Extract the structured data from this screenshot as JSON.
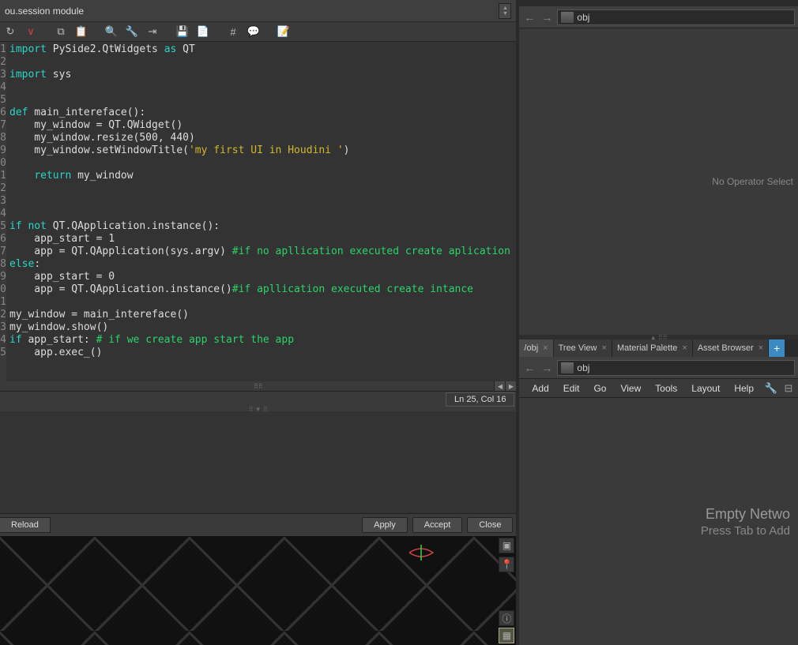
{
  "title": "ou.session module",
  "status": "Ln 25, Col 16",
  "code_lines": [
    "1",
    "2",
    "3",
    "4",
    "5",
    "6",
    "7",
    "8",
    "9",
    "0",
    "1",
    "2",
    "3",
    "4",
    "5",
    "6",
    "7",
    "8",
    "9",
    "0",
    "1",
    "2",
    "3",
    "4",
    "5"
  ],
  "buttons": {
    "reload": "Reload",
    "apply": "Apply",
    "accept": "Accept",
    "close": "Close"
  },
  "right": {
    "path": "obj",
    "no_op": "No Operator Select",
    "tabs": [
      "/obj",
      "Tree View",
      "Material Palette",
      "Asset Browser"
    ],
    "path2": "obj",
    "menu": [
      "Add",
      "Edit",
      "Go",
      "View",
      "Tools",
      "Layout",
      "Help"
    ],
    "empty1": "Empty Netwo",
    "empty2": "Press Tab to Add "
  },
  "code": {
    "l1_kw": "import",
    "l1_rest": " PySide2.QtWidgets ",
    "l1_as": "as",
    "l1_end": " QT",
    "l3_kw": "import",
    "l3_rest": " sys",
    "l6_kw": "def",
    "l6_rest": " main_intereface():",
    "l7": "    my_window = QT.QWidget()",
    "l8": "    my_window.resize(500, 440)",
    "l9a": "    my_window.setWindowTitle(",
    "l9_str": "'my first UI in Houdini '",
    "l9b": ")",
    "l11_sp": "    ",
    "l11_kw": "return",
    "l11_rest": " my_window",
    "l15_if": "if",
    "l15_not": " not",
    "l15_rest": " QT.QApplication.instance():",
    "l16": "    app_start = 1",
    "l17a": "    app = QT.QApplication(sys.argv) ",
    "l17_com": "#if no apllication executed create aplication",
    "l18_kw": "else",
    "l18_rest": ":",
    "l19": "    app_start = 0",
    "l20a": "    app = QT.QApplication.instance()",
    "l20_com": "#if apllication executed create intance",
    "l22": "my_window = main_intereface()",
    "l23": "my_window.show()",
    "l24_kw": "if",
    "l24_rest": " app_start: ",
    "l24_com": "# if we create app start the app",
    "l25": "    app.exec_()"
  }
}
